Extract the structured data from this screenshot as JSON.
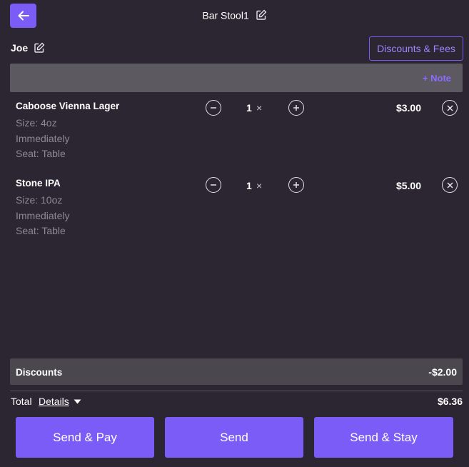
{
  "header": {
    "title": "Bar Stool1",
    "customer_name": "Joe",
    "discounts_fees_label": "Discounts & Fees"
  },
  "note": {
    "add_label": "+ Note"
  },
  "items": [
    {
      "name": "Caboose Vienna Lager",
      "size": "Size: 4oz",
      "timing": "Immediately",
      "seat": "Seat: Table",
      "quantity": "1",
      "times": "×",
      "price": "$3.00"
    },
    {
      "name": "Stone IPA",
      "size": "Size: 10oz",
      "timing": "Immediately",
      "seat": "Seat: Table",
      "quantity": "1",
      "times": "×",
      "price": "$5.00"
    }
  ],
  "discounts": {
    "label": "Discounts",
    "amount": "-$2.00"
  },
  "total": {
    "label": "Total",
    "details_label": "Details",
    "amount": "$6.36"
  },
  "actions": {
    "send_pay": "Send & Pay",
    "send": "Send",
    "send_stay": "Send & Stay"
  },
  "colors": {
    "accent": "#7b5cf6",
    "background": "#2b2631",
    "note_bar": "#5c5960",
    "discount_bar": "#4a474f"
  }
}
